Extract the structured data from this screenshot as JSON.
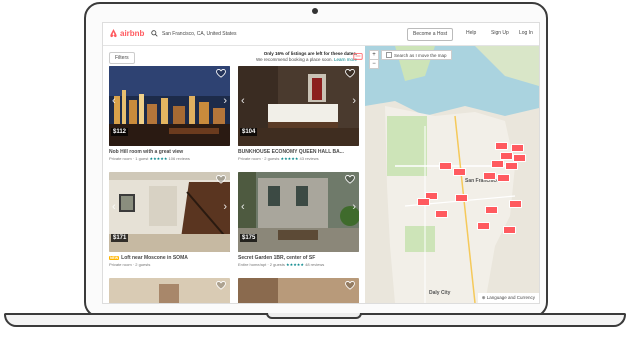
{
  "header": {
    "logo_text": "airbnb",
    "search_value": "San Francisco, CA, United States",
    "nav": [
      "Become a Host",
      "Help",
      "Sign Up",
      "Log In"
    ]
  },
  "listings": {
    "filters_label": "Filters",
    "notice_bold": "Only 16% of listings are left for these dates.",
    "notice_text": "We recommend booking a place soon.",
    "notice_link": "Learn more",
    "cards": [
      {
        "price": "$112",
        "title": "Nob Hill room with a great view",
        "sub": "Private room · 1 guest",
        "stars": "★★★★★",
        "reviews": "106 reviews",
        "new": ""
      },
      {
        "price": "$104",
        "title": "BUNKHOUSE ECONOMY QUEEN HALL BA...",
        "sub": "Private room · 2 guests",
        "stars": "★★★★★",
        "reviews": "43 reviews",
        "new": ""
      },
      {
        "price": "$171",
        "title": "Loft near Moscone in SOMA",
        "sub": "Private room · 2 guests",
        "stars": "",
        "reviews": "",
        "new": "NEW"
      },
      {
        "price": "$175",
        "title": "Secret Garden 1BR, center of SF",
        "sub": "Entire home/apt · 2 guests",
        "stars": "★★★★★",
        "reviews": "48 reviews",
        "new": ""
      }
    ]
  },
  "map": {
    "zoom_in": "+",
    "zoom_out": "−",
    "search_toggle": "Search as I move the map",
    "labels": [
      "San Francisco",
      "Daly City"
    ],
    "language_label": "⊕ Language and Currency"
  },
  "colors": {
    "brand": "#ff5a5f",
    "teal": "#008489"
  }
}
